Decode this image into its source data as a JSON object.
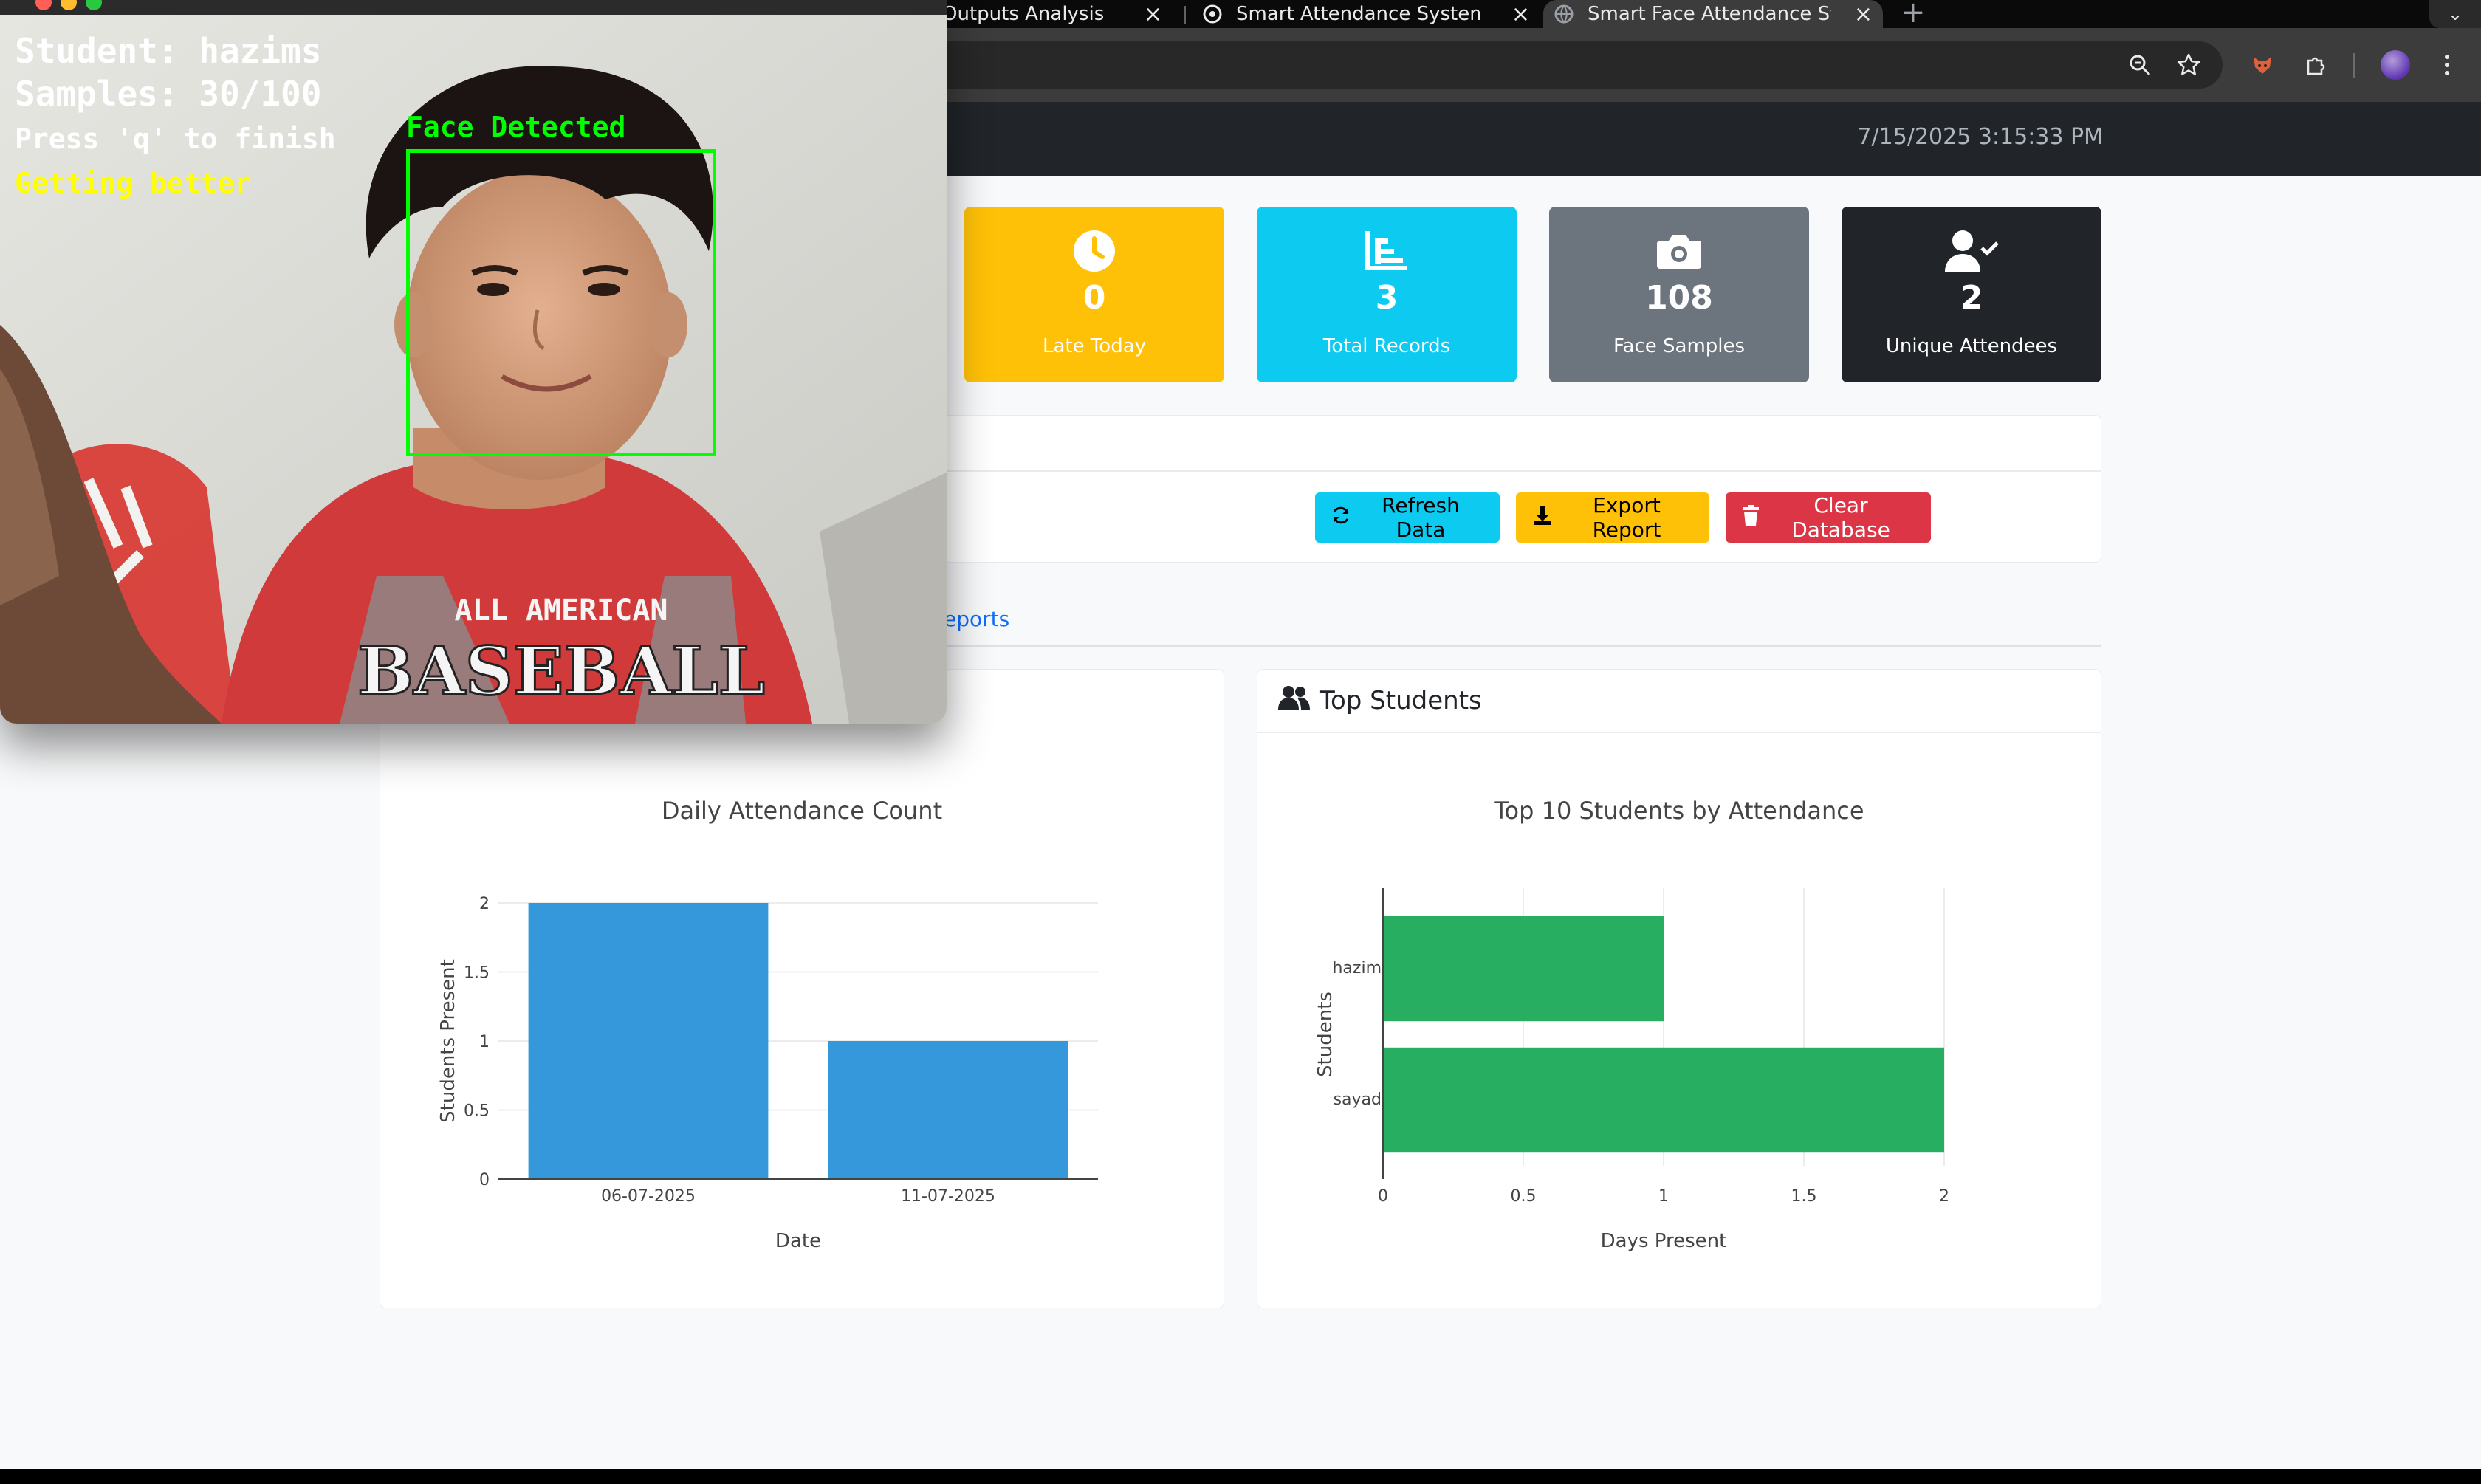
{
  "browser": {
    "tabs": [
      {
        "label": "Outputs Analysis",
        "active": false
      },
      {
        "label": "Smart Attendance System Ba",
        "active": false
      },
      {
        "label": "Smart Face Attendance Syste",
        "active": true
      }
    ],
    "new_tab": "+",
    "tab_close": "×",
    "tab_search": "⌄"
  },
  "app": {
    "datetime": "7/15/2025 3:15:33 PM"
  },
  "stats": {
    "late": {
      "value": "0",
      "label": "Late Today",
      "icon": "clock-icon",
      "color": "#ffc107"
    },
    "total": {
      "value": "3",
      "label": "Total Records",
      "icon": "bar-chart-icon",
      "color": "#0dcaf0"
    },
    "faces": {
      "value": "108",
      "label": "Face Samples",
      "icon": "camera-icon",
      "color": "#6c757d"
    },
    "unique": {
      "value": "2",
      "label": "Unique Attendees",
      "icon": "user-check-icon",
      "color": "#212529"
    }
  },
  "controls": {
    "refresh_label": "Refresh Data",
    "export_label": "Export Report",
    "clear_label": "Clear Database"
  },
  "nav": {
    "reports_tab": "eports"
  },
  "panels": {
    "top_students_title": "Top Students"
  },
  "camera": {
    "student_line": "Student: hazims",
    "samples_line": "Samples: 30/100",
    "press_line": "Press 'q' to finish",
    "quality_line": "Getting better",
    "detected_label": "Face Detected",
    "shirt_text_1": "ALL AMERICAN",
    "shirt_text_2": "BASEBALL"
  },
  "chart_data": [
    {
      "type": "bar",
      "title": "Daily Attendance Count",
      "xlabel": "Date",
      "ylabel": "Students Present",
      "categories": [
        "06-07-2025",
        "11-07-2025"
      ],
      "values": [
        2,
        1
      ],
      "ylim": [
        0,
        2
      ],
      "yticks": [
        "0",
        "0.5",
        "1",
        "1.5",
        "2"
      ],
      "color": "#3498db",
      "grid": true
    },
    {
      "type": "bar",
      "orientation": "horizontal",
      "title": "Top 10 Students by Attendance",
      "xlabel": "Days Present",
      "ylabel": "Students",
      "categories": [
        "hazim",
        "sayad"
      ],
      "values": [
        1,
        2
      ],
      "xlim": [
        0,
        2
      ],
      "xticks": [
        "0",
        "0.5",
        "1",
        "1.5",
        "2"
      ],
      "color": "#27ae60",
      "grid": true
    }
  ]
}
